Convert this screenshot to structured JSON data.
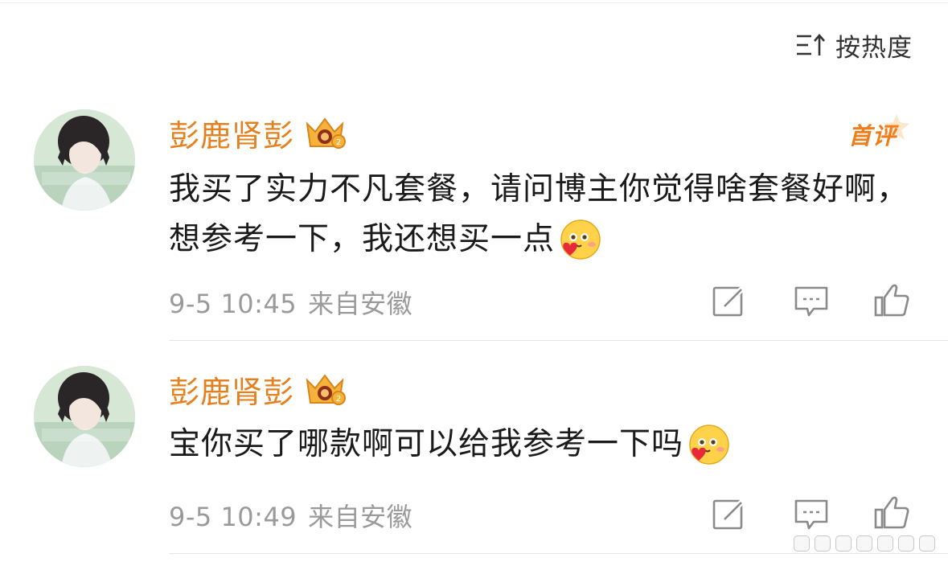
{
  "sort": {
    "label": "按热度",
    "icon": "sort-filter-icon"
  },
  "colors": {
    "username": "#e4801d",
    "first_badge": "#f07d1b",
    "meta": "#9a9a9a",
    "divider": "#e6e6e6"
  },
  "comments": [
    {
      "username": "彭鹿肾彭",
      "badge_icon": "crown-badge-icon",
      "tag": "首评",
      "text": "我买了实力不凡套餐，请问博主你觉得啥套餐好啊，想参考一下，我还想买一点",
      "emoji": "heart-emoji-icon",
      "time": "9-5 10:45",
      "source": "来自安徽",
      "actions": [
        "share-icon",
        "comment-icon",
        "like-icon"
      ]
    },
    {
      "username": "彭鹿肾彭",
      "badge_icon": "crown-badge-icon",
      "text": "宝你买了哪款啊可以给我参考一下吗",
      "emoji": "heart-emoji-icon",
      "time": "9-5 10:49",
      "source": "来自安徽",
      "actions": [
        "share-icon",
        "comment-icon",
        "like-icon"
      ]
    }
  ]
}
